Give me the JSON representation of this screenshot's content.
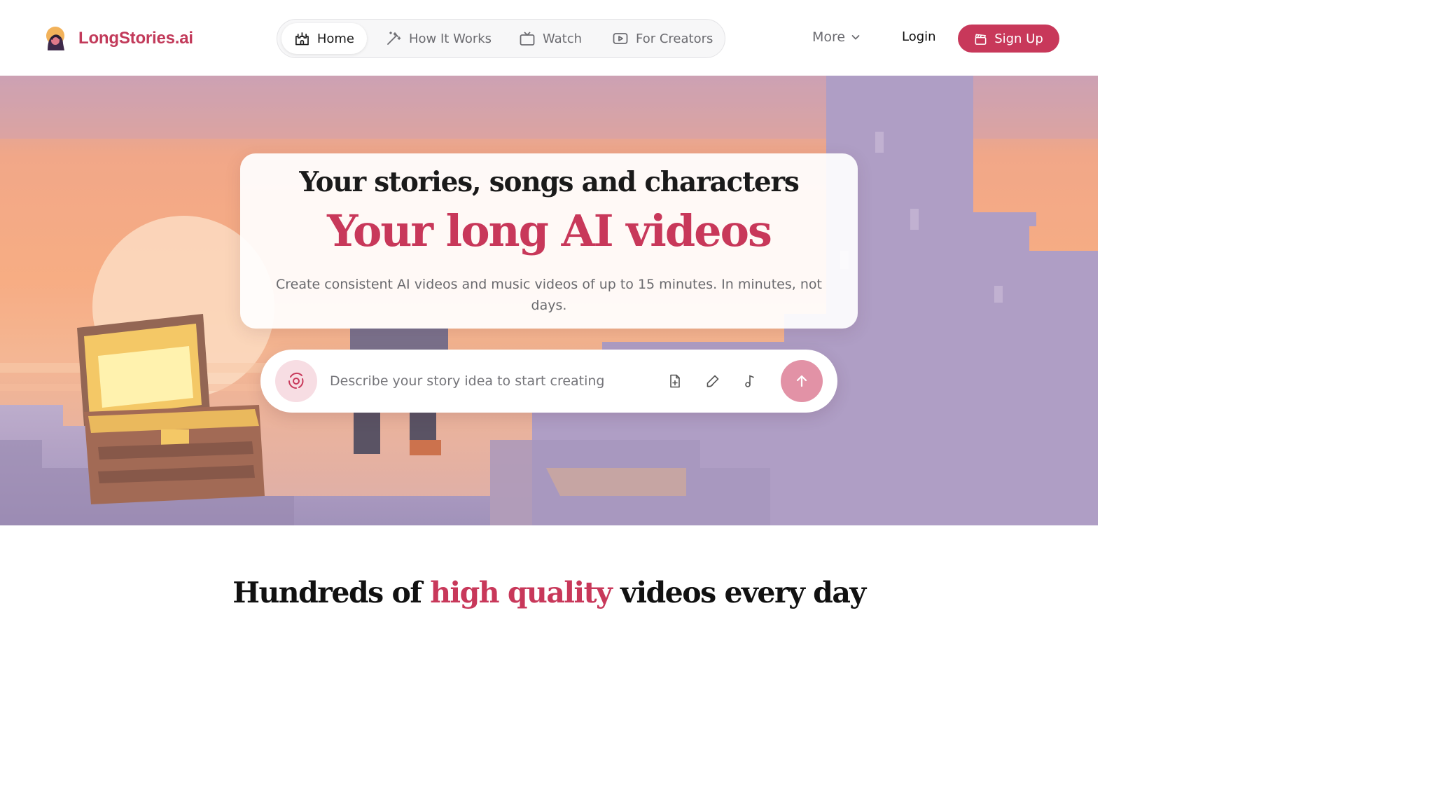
{
  "header": {
    "brand_name": "LongStories.ai",
    "brand_logo_icon": "hooded-character-logo",
    "nav": [
      {
        "label": "Home",
        "icon": "castle-icon",
        "active": true
      },
      {
        "label": "How It Works",
        "icon": "magic-wand-icon",
        "active": false
      },
      {
        "label": "Watch",
        "icon": "tv-icon",
        "active": false
      },
      {
        "label": "For Creators",
        "icon": "video-play-icon",
        "active": false
      }
    ],
    "more_label": "More",
    "login_label": "Login",
    "signup_label": "Sign Up",
    "signup_icon": "clapperboard-icon"
  },
  "hero": {
    "eyebrow": "Your stories, songs and characters",
    "title": "Your long AI videos",
    "subtitle": "Create consistent AI videos and music videos of up to 15 minutes. In minutes, not days.",
    "prompt": {
      "placeholder": "Describe your story idea to start creating",
      "badge_icon": "spark-orbit-icon",
      "tools": [
        "document-add-icon",
        "pen-icon",
        "music-note-icon"
      ],
      "send_icon": "arrow-up-icon"
    }
  },
  "section": {
    "title_before": "Hundreds of ",
    "title_accent": "high quality",
    "title_after": " videos every day"
  },
  "colors": {
    "brand": "#c8385a",
    "send_button": "#e292a6",
    "badge_bg": "#f7dde3",
    "sky_top": "#d59d9c",
    "sky_orange": "#f6a37a",
    "castle_purple": "#a996c0"
  }
}
